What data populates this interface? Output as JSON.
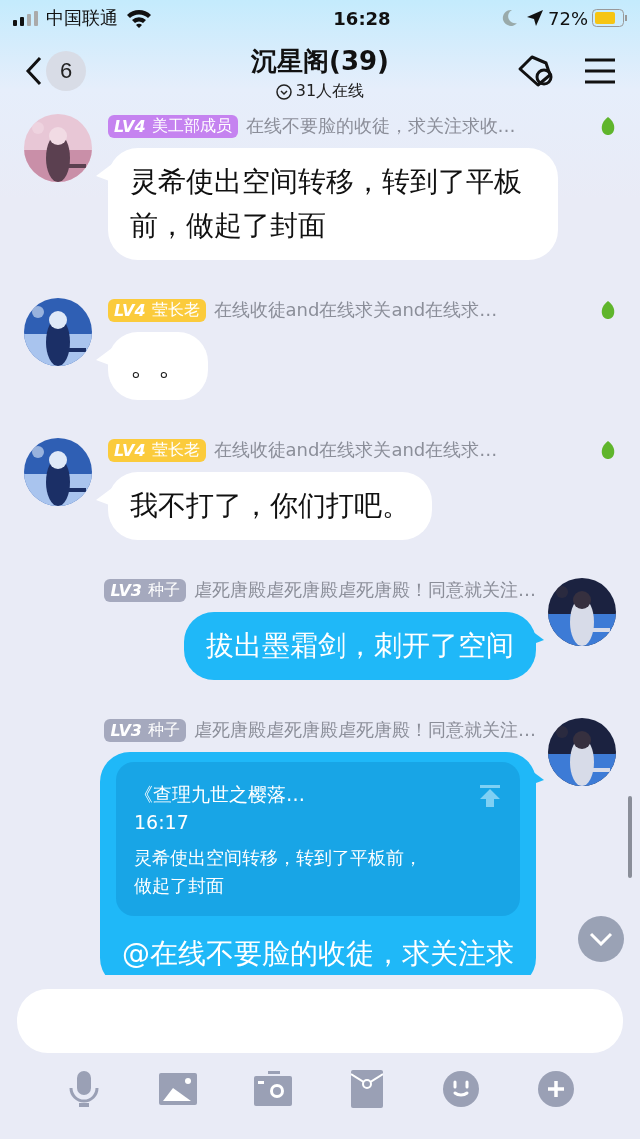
{
  "status_bar": {
    "carrier": "中国联通",
    "time": "16:28",
    "battery": "72%"
  },
  "header": {
    "back_count": "6",
    "title": "沉星阁(39)",
    "online": "31人在线"
  },
  "messages": [
    {
      "kind": "incoming",
      "level": "LV4",
      "rank": "美工部成员",
      "color": "#c583f0",
      "signature": "在线不要脸的收徒，求关注求收…",
      "text": "灵希使出空间转移，转到了平板前，做起了封面"
    },
    {
      "kind": "incoming",
      "level": "LV4",
      "rank": "莹长老",
      "color": "#fbcb3c",
      "signature": "在线收徒and在线求关and在线求…",
      "text": "。。"
    },
    {
      "kind": "incoming",
      "level": "LV4",
      "rank": "莹长老",
      "color": "#fbcb3c",
      "signature": "在线收徒and在线求关and在线求…",
      "text": "我不打了，你们打吧。"
    },
    {
      "kind": "outgoing",
      "level": "LV3",
      "rank": "种子",
      "color": "#a5a9be",
      "signature": "虐死唐殿虐死唐殿虐死唐殿！同意就关注…",
      "text": "拔出墨霜剑，刺开了空间"
    },
    {
      "kind": "outgoing",
      "level": "LV3",
      "rank": "种子",
      "color": "#a5a9be",
      "signature": "虐死唐殿虐死唐殿虐死唐殿！同意就关注…",
      "quote": {
        "title": "《查理九世之樱落…",
        "time": "16:17",
        "text": "灵希使出空间转移，转到了平板前，做起了封面"
      },
      "text": "@在线不要脸的收徒，求关注求"
    }
  ]
}
